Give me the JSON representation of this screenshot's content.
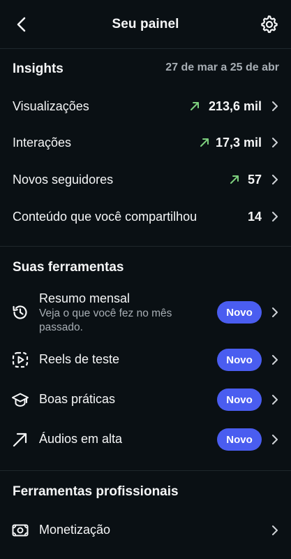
{
  "header": {
    "title": "Seu painel",
    "back_icon": "back-icon",
    "settings_icon": "gear-icon"
  },
  "insights": {
    "title": "Insights",
    "date_range": "27 de mar a 25 de abr",
    "rows": [
      {
        "label": "Visualizações",
        "value": "213,6 mil",
        "trend": "up"
      },
      {
        "label": "Interações",
        "value": "17,3 mil",
        "trend": "up"
      },
      {
        "label": "Novos seguidores",
        "value": "57",
        "trend": "up"
      },
      {
        "label": "Conteúdo que você compartilhou",
        "value": "14"
      }
    ]
  },
  "tools": {
    "title": "Suas ferramentas",
    "items": [
      {
        "label": "Resumo mensal",
        "subtitle": "Veja o que você fez no mês passado.",
        "badge": "Novo",
        "icon": "history-icon"
      },
      {
        "label": "Reels de teste",
        "badge": "Novo",
        "icon": "reels-test-icon"
      },
      {
        "label": "Boas práticas",
        "badge": "Novo",
        "icon": "graduation-cap-icon"
      },
      {
        "label": "Áudios em alta",
        "badge": "Novo",
        "icon": "trending-arrow-icon"
      }
    ]
  },
  "pro_tools": {
    "title": "Ferramentas profissionais",
    "items": [
      {
        "label": "Monetização",
        "icon": "money-icon"
      }
    ]
  },
  "colors": {
    "background": "#0a1014",
    "accent": "#4a5df0",
    "trend_up": "#7ed07e",
    "muted_text": "#a7aeb4"
  }
}
